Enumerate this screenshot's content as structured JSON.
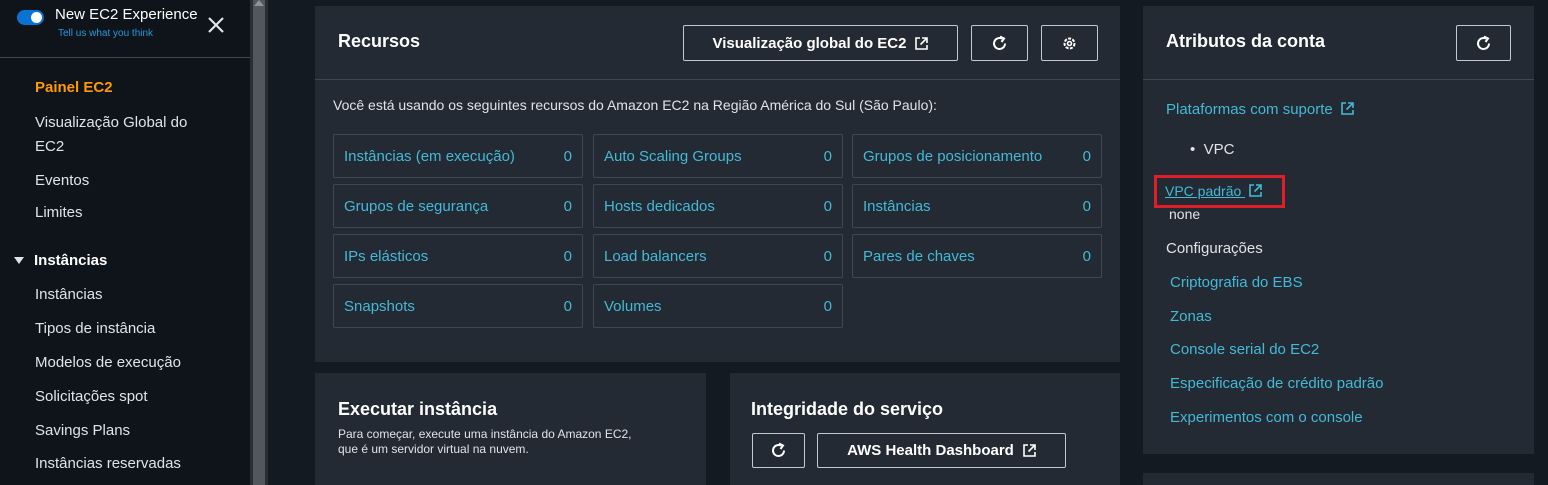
{
  "sidebar": {
    "experience_title": "New EC2 Experience",
    "experience_sub": "Tell us what you think",
    "active_item": "Painel EC2",
    "items_top": [
      "Visualização Global do",
      "EC2",
      "Eventos",
      "Limites"
    ],
    "section": "Instâncias",
    "items_section": [
      "Instâncias",
      "Tipos de instância",
      "Modelos de execução",
      "Solicitações spot",
      "Savings Plans",
      "Instâncias reservadas"
    ]
  },
  "resources": {
    "title": "Recursos",
    "global_view_button": "Visualização global do EC2",
    "intro": "Você está usando os seguintes recursos do Amazon EC2 na Região América do Sul (São Paulo):",
    "items": [
      {
        "label": "Instâncias (em execução)",
        "count": "0"
      },
      {
        "label": "Auto Scaling Groups",
        "count": "0"
      },
      {
        "label": "Grupos de posicionamento",
        "count": "0"
      },
      {
        "label": "Grupos de segurança",
        "count": "0"
      },
      {
        "label": "Hosts dedicados",
        "count": "0"
      },
      {
        "label": "Instâncias",
        "count": "0"
      },
      {
        "label": "IPs elásticos",
        "count": "0"
      },
      {
        "label": "Load balancers",
        "count": "0"
      },
      {
        "label": "Pares de chaves",
        "count": "0"
      },
      {
        "label": "Snapshots",
        "count": "0"
      },
      {
        "label": "Volumes",
        "count": "0"
      }
    ]
  },
  "launch": {
    "title": "Executar instância",
    "desc_line1": "Para começar, execute uma instância do Amazon EC2,",
    "desc_line2": "que é um servidor virtual na nuvem."
  },
  "health": {
    "title": "Integridade do serviço",
    "dashboard_button": "AWS Health Dashboard"
  },
  "account": {
    "title": "Atributos da conta",
    "platforms_link": "Plataformas com suporte",
    "platform_item": "VPC",
    "vpc_default_link": "VPC padrão",
    "vpc_default_value": "none",
    "settings_heading": "Configurações",
    "settings_links": [
      "Criptografia do EBS",
      "Zonas",
      "Console serial do EC2",
      "Especificação de crédito padrão",
      "Experimentos com o console"
    ]
  },
  "colors": {
    "accent_orange": "#ff9900",
    "link_blue": "#44b9d6",
    "highlight_red": "#e01e27",
    "toggle_blue": "#0972d3"
  }
}
